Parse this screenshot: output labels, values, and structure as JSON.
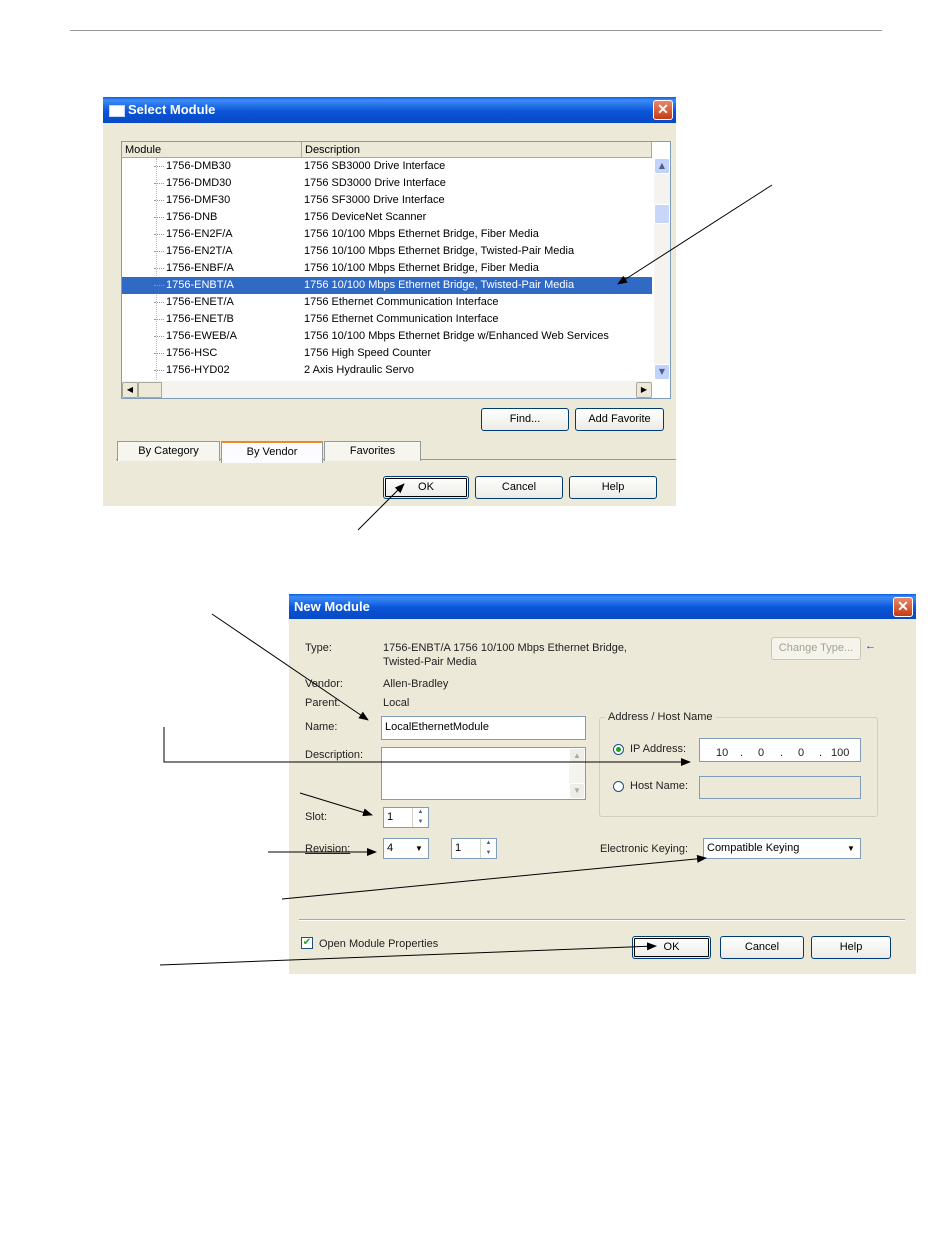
{
  "select_module": {
    "title": "Select Module",
    "col_module": "Module",
    "col_description": "Description",
    "rows": [
      {
        "module": "1756-DMB30",
        "description": "1756 SB3000 Drive Interface"
      },
      {
        "module": "1756-DMD30",
        "description": "1756 SD3000 Drive Interface"
      },
      {
        "module": "1756-DMF30",
        "description": "1756 SF3000 Drive Interface"
      },
      {
        "module": "1756-DNB",
        "description": "1756 DeviceNet Scanner"
      },
      {
        "module": "1756-EN2F/A",
        "description": "1756 10/100 Mbps Ethernet Bridge, Fiber Media"
      },
      {
        "module": "1756-EN2T/A",
        "description": "1756 10/100 Mbps Ethernet Bridge, Twisted-Pair Media"
      },
      {
        "module": "1756-ENBF/A",
        "description": "1756 10/100 Mbps Ethernet Bridge, Fiber Media"
      },
      {
        "module": "1756-ENBT/A",
        "description": "1756 10/100 Mbps Ethernet Bridge, Twisted-Pair Media",
        "selected": true
      },
      {
        "module": "1756-ENET/A",
        "description": "1756 Ethernet Communication Interface"
      },
      {
        "module": "1756-ENET/B",
        "description": "1756 Ethernet Communication Interface"
      },
      {
        "module": "1756-EWEB/A",
        "description": "1756 10/100 Mbps Ethernet Bridge w/Enhanced Web Services"
      },
      {
        "module": "1756-HSC",
        "description": "1756 High Speed Counter"
      },
      {
        "module": "1756-HYD02",
        "description": "2 Axis Hydraulic Servo"
      }
    ],
    "find_label": "Find...",
    "add_favorite_label": "Add Favorite",
    "tabs": [
      "By Category",
      "By Vendor",
      "Favorites"
    ],
    "ok_label": "OK",
    "cancel_label": "Cancel",
    "help_label": "Help"
  },
  "new_module": {
    "title": "New Module",
    "type_label": "Type:",
    "type_value_line1": "1756-ENBT/A 1756 10/100 Mbps Ethernet Bridge,",
    "type_value_line2": "Twisted-Pair Media",
    "change_type_label": "Change Type...",
    "vendor_label": "Vendor:",
    "vendor_value": "Allen-Bradley",
    "parent_label": "Parent:",
    "parent_value": "Local",
    "name_label": "Name:",
    "name_value": "LocalEthernetModule",
    "description_label": "Description:",
    "address_group_label": "Address / Host Name",
    "ip_address_label": "IP Address:",
    "ip_octets": [
      "10",
      "0",
      "0",
      "100"
    ],
    "ip_dot": ".",
    "host_name_label": "Host Name:",
    "slot_label": "Slot:",
    "slot_value": "1",
    "revision_label": "Revision:",
    "revision_major": "4",
    "revision_minor": "1",
    "keying_label": "Electronic Keying:",
    "keying_value": "Compatible Keying",
    "open_props_label": "Open Module Properties",
    "ok_label": "OK",
    "cancel_label": "Cancel",
    "help_label": "Help"
  }
}
